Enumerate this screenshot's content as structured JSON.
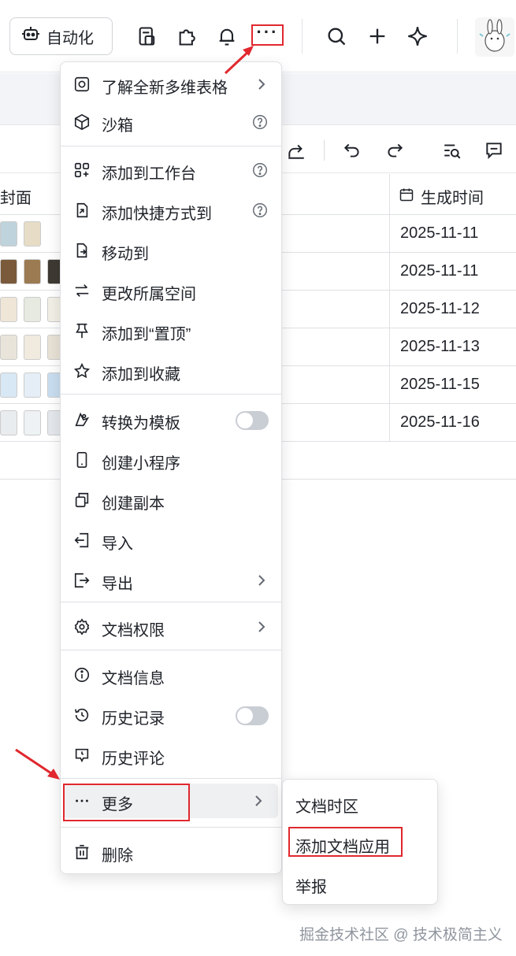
{
  "topbar": {
    "automation_label": "自动化",
    "more_glyph": "···",
    "icons": [
      "robot-icon",
      "doc-template-icon",
      "plugin-icon",
      "bell-icon",
      "more-icon",
      "search-icon",
      "plus-icon",
      "sparkle-icon",
      "avatar"
    ]
  },
  "table": {
    "col_cover": "封面",
    "col_time": "生成时间",
    "rows": [
      {
        "date": "2025-11-11"
      },
      {
        "date": "2025-11-11"
      },
      {
        "date": "2025-11-12"
      },
      {
        "date": "2025-11-13"
      },
      {
        "date": "2025-11-15"
      },
      {
        "date": "2025-11-16"
      }
    ]
  },
  "menu": {
    "items": [
      {
        "label": "了解全新多维表格",
        "icon": "bitable-icon",
        "trailing": "chevron"
      },
      {
        "label": "沙箱",
        "icon": "cube-icon",
        "trailing": "help"
      },
      {
        "label": "添加到工作台",
        "icon": "apps-add-icon",
        "trailing": "help"
      },
      {
        "label": "添加快捷方式到",
        "icon": "shortcut-icon",
        "trailing": "help"
      },
      {
        "label": "移动到",
        "icon": "move-icon",
        "trailing": ""
      },
      {
        "label": "更改所属空间",
        "icon": "swap-icon",
        "trailing": ""
      },
      {
        "label": "添加到“置顶”",
        "icon": "pin-icon",
        "trailing": ""
      },
      {
        "label": "添加到收藏",
        "icon": "star-icon",
        "trailing": ""
      },
      {
        "label": "转换为模板",
        "icon": "template-icon",
        "trailing": "toggle"
      },
      {
        "label": "创建小程序",
        "icon": "phone-icon",
        "trailing": ""
      },
      {
        "label": "创建副本",
        "icon": "copy-icon",
        "trailing": ""
      },
      {
        "label": "导入",
        "icon": "import-icon",
        "trailing": ""
      },
      {
        "label": "导出",
        "icon": "export-icon",
        "trailing": "chevron"
      },
      {
        "label": "文档权限",
        "icon": "gear-icon",
        "trailing": "chevron"
      },
      {
        "label": "文档信息",
        "icon": "info-icon",
        "trailing": ""
      },
      {
        "label": "历史记录",
        "icon": "history-icon",
        "trailing": "toggle"
      },
      {
        "label": "历史评论",
        "icon": "comment-history-icon",
        "trailing": ""
      },
      {
        "label": "更多",
        "icon": "ellipsis-icon",
        "trailing": "chevron"
      },
      {
        "label": "删除",
        "icon": "trash-icon",
        "trailing": ""
      }
    ]
  },
  "submenu": {
    "items": [
      "文档时区",
      "添加文档应用",
      "举报"
    ]
  },
  "watermark": "掘金技术社区 @ 技术极简主义",
  "colors": {
    "highlight_red": "#e0282e",
    "border": "#dee0e3",
    "text": "#1f2329"
  }
}
